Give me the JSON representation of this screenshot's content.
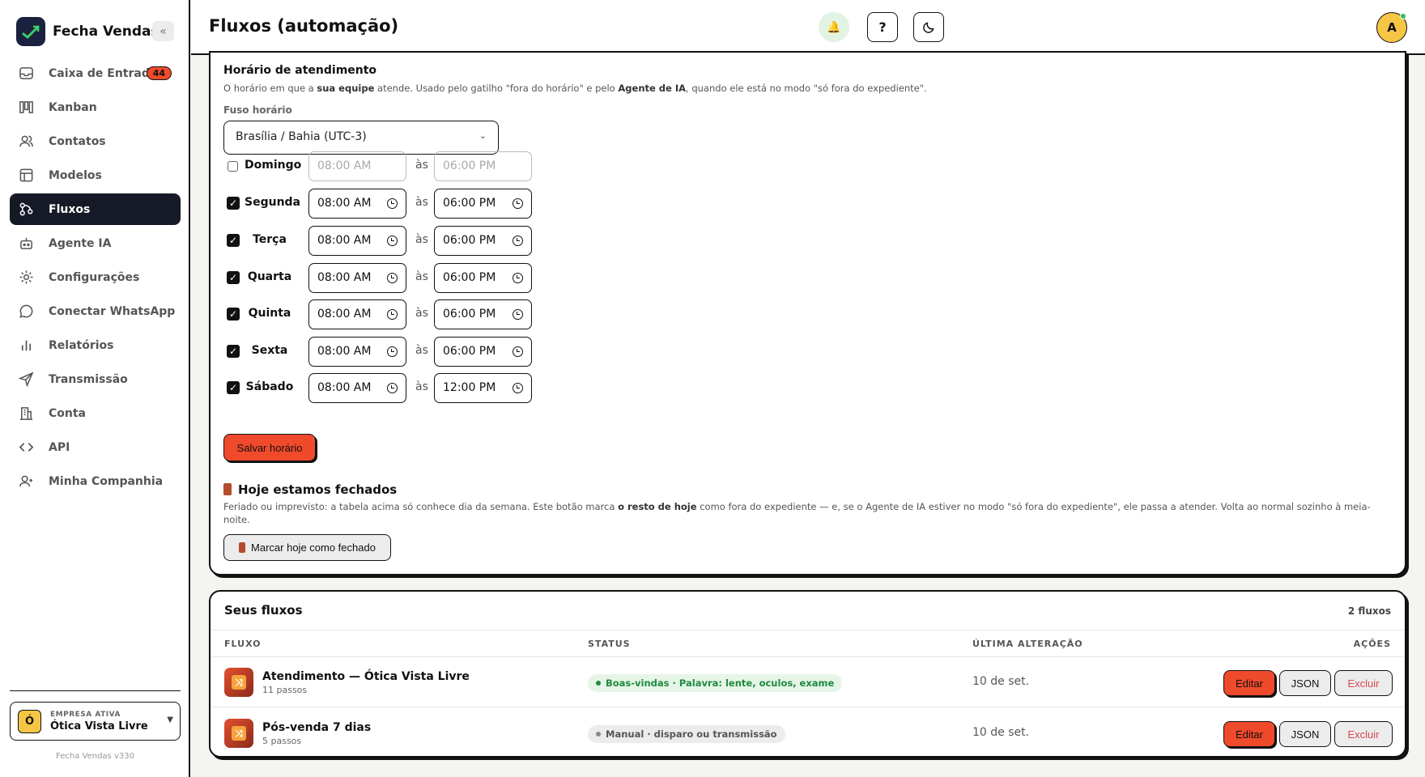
{
  "brand": {
    "name": "Fecha Vendas",
    "collapse_label": "«"
  },
  "sidebar": {
    "items": [
      {
        "label": "Caixa de Entrada",
        "icon": "inbox-icon",
        "badge": "44"
      },
      {
        "label": "Kanban",
        "icon": "kanban-icon"
      },
      {
        "label": "Contatos",
        "icon": "users-icon"
      },
      {
        "label": "Modelos",
        "icon": "template-icon"
      },
      {
        "label": "Fluxos",
        "icon": "workflow-icon",
        "active": true
      },
      {
        "label": "Agente IA",
        "icon": "bot-icon"
      },
      {
        "label": "Configurações",
        "icon": "gear-icon"
      },
      {
        "label": "Conectar WhatsApp",
        "icon": "chat-icon"
      },
      {
        "label": "Relatórios",
        "icon": "bar-chart-icon"
      },
      {
        "label": "Transmissão",
        "icon": "send-icon"
      },
      {
        "label": "Conta",
        "icon": "building-icon"
      },
      {
        "label": "API",
        "icon": "code-icon"
      },
      {
        "label": "Minha Companhia",
        "icon": "team-icon"
      }
    ],
    "company": {
      "label": "EMPRESA ATIVA",
      "name": "Ótica Vista Livre",
      "initial": "Ó"
    },
    "version": "Fecha Vendas v330"
  },
  "header": {
    "title": "Fluxos (automação)",
    "help_label": "?",
    "avatar_initial": "A"
  },
  "schedule": {
    "title": "Horário de atendimento",
    "desc_1": "O horário em que a ",
    "desc_b1": "sua equipe",
    "desc_2": " atende. Usado pelo gatilho \"fora do horário\" e pelo ",
    "desc_b2": "Agente de IA",
    "desc_3": ", quando ele está no modo \"só fora do expediente\".",
    "tz_label": "Fuso horário",
    "tz_value": "Brasília / Bahia (UTC-3)",
    "sep": "às",
    "days": [
      {
        "name": "Domingo",
        "checked": false,
        "start": "08:00 AM",
        "end": "06:00 PM"
      },
      {
        "name": "Segunda",
        "checked": true,
        "start": "08:00 AM",
        "end": "06:00 PM"
      },
      {
        "name": "Terça",
        "checked": true,
        "start": "08:00 AM",
        "end": "06:00 PM"
      },
      {
        "name": "Quarta",
        "checked": true,
        "start": "08:00 AM",
        "end": "06:00 PM"
      },
      {
        "name": "Quinta",
        "checked": true,
        "start": "08:00 AM",
        "end": "06:00 PM"
      },
      {
        "name": "Sexta",
        "checked": true,
        "start": "08:00 AM",
        "end": "06:00 PM"
      },
      {
        "name": "Sábado",
        "checked": true,
        "start": "08:00 AM",
        "end": "12:00 PM"
      }
    ],
    "save_label": "Salvar horário"
  },
  "closed_today": {
    "title": "Hoje estamos fechados",
    "desc_1": "Feriado ou imprevisto: a tabela acima só conhece dia da semana. Este botão marca ",
    "desc_b": "o resto de hoje",
    "desc_2": " como fora do expediente — e, se o Agente de IA estiver no modo \"só fora do expediente\", ele passa a atender. Volta ao normal sozinho à meia-noite.",
    "button_label": "Marcar hoje como fechado"
  },
  "flows": {
    "title": "Seus fluxos",
    "count": "2 fluxos",
    "columns": [
      "FLUXO",
      "STATUS",
      "ÚLTIMA ALTERAÇÃO",
      "AÇÕES"
    ],
    "rows": [
      {
        "name": "Atendimento — Ótica Vista Livre",
        "steps": "11 passos",
        "status": "Boas-vindas · Palavra: lente, oculos, exame",
        "status_color": "#1f8a3d",
        "date": "10 de set."
      },
      {
        "name": "Pós-venda 7 dias",
        "steps": "5 passos",
        "status": "Manual · disparo ou transmissão",
        "status_color": "#555555",
        "date": "10 de set."
      }
    ],
    "actions": {
      "edit": "Editar",
      "json": "JSON",
      "delete": "Excluir"
    }
  },
  "colors": {
    "accent": "#f04a2c",
    "dark": "#161a26",
    "highlight": "#f7c544"
  }
}
